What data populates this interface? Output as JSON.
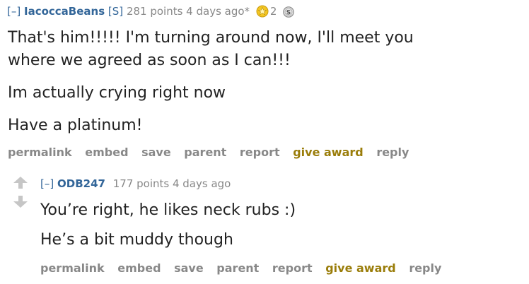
{
  "comments": [
    {
      "expand": "[–]",
      "author": "IacoccaBeans",
      "submitter_tag": "[S]",
      "score_time": "281 points 4 days ago*",
      "award_count": "2",
      "paragraphs": [
        "That's him!!!!! I'm turning around now, I'll meet you",
        "where we agreed as soon as I can!!!",
        "Im actually crying right now",
        "Have a platinum!"
      ],
      "buttons": [
        "permalink",
        "embed",
        "save",
        "parent",
        "report",
        "give award",
        "reply"
      ]
    },
    {
      "expand": "[–]",
      "author": "ODB247",
      "score_time": "177 points 4 days ago",
      "paragraphs": [
        "You’re right, he likes neck rubs :)",
        "He’s a bit muddy though"
      ],
      "buttons": [
        "permalink",
        "embed",
        "save",
        "parent",
        "report",
        "give award",
        "reply"
      ]
    }
  ],
  "colors": {
    "author": "#336699",
    "award": "#9a7d0a",
    "meta": "#888888",
    "text": "#222222",
    "arrow": "#c6c6c6"
  },
  "icons": {
    "gold_award": "award-medal-icon",
    "silver_award": "silver-coin-icon",
    "upvote": "upvote-arrow-icon",
    "downvote": "downvote-arrow-icon"
  }
}
